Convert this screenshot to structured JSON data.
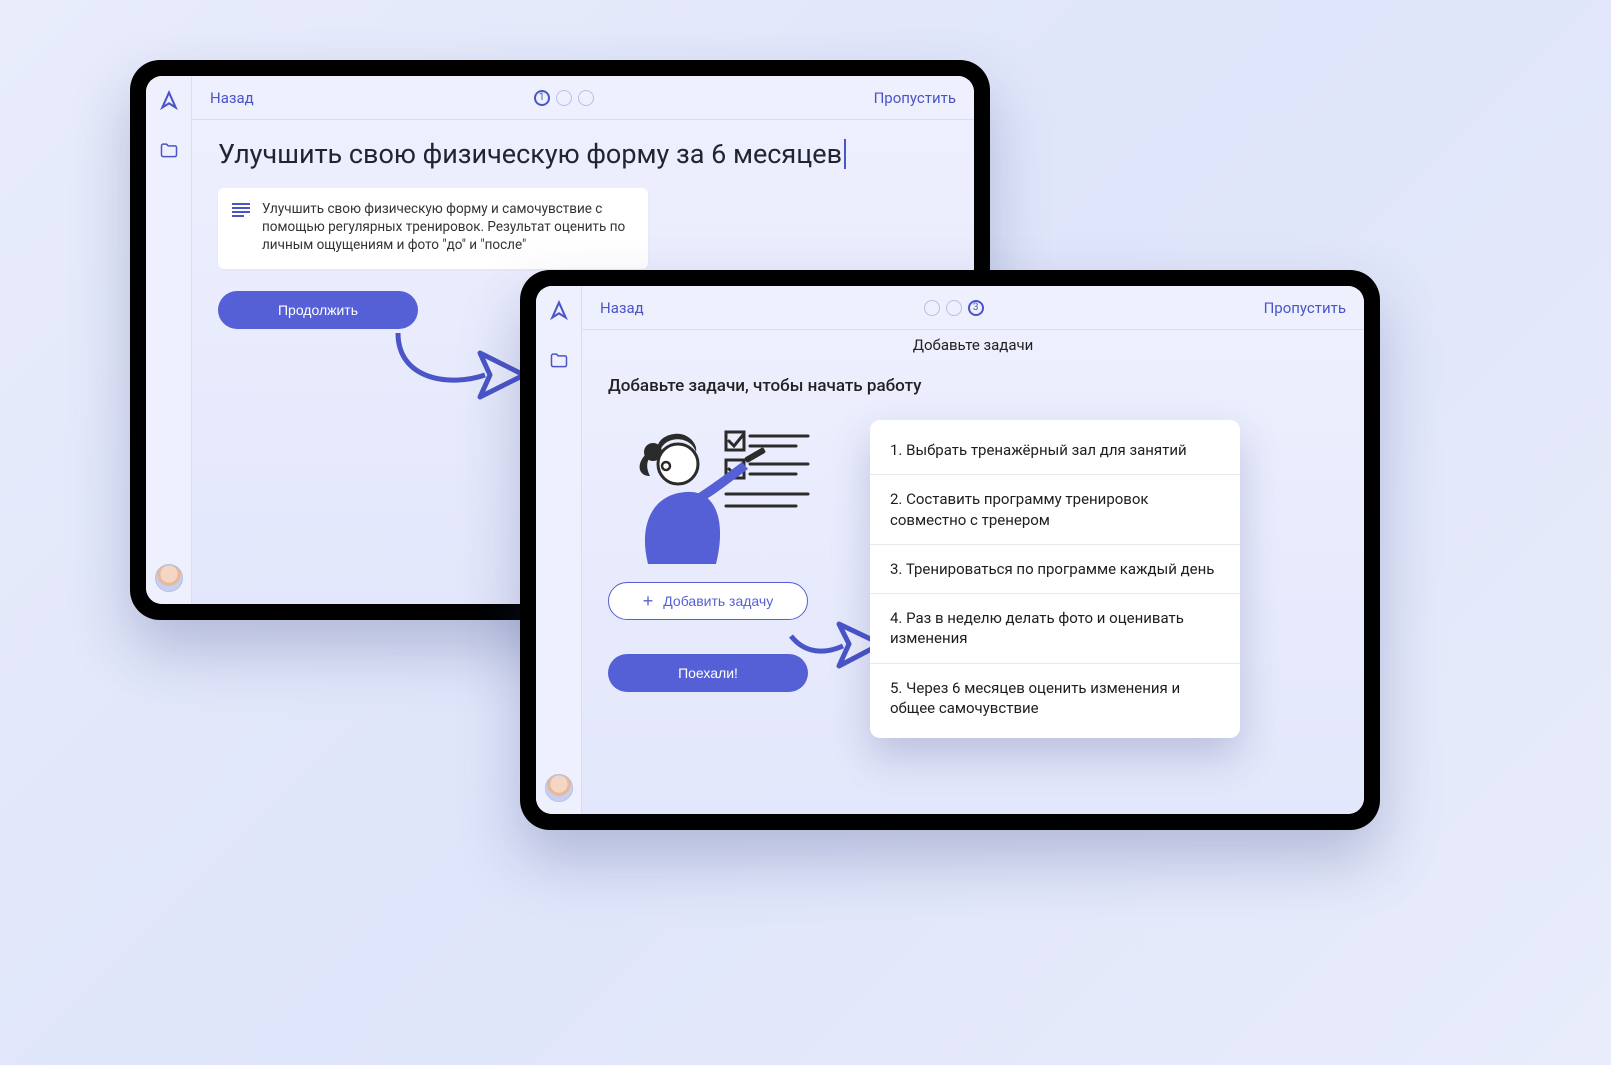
{
  "colors": {
    "accent": "#5560d6",
    "accent_dark": "#4a55c7",
    "bg_grad_a": "#e8ecfb",
    "bg_grad_b": "#dfe5fa"
  },
  "screen1": {
    "back_label": "Назад",
    "skip_label": "Пропустить",
    "step_current": 1,
    "step_total": 3,
    "goal_title": "Улучшить свою физическую форму за 6 месяцев",
    "note": "Улучшить свою физическую форму и самочувствие с помощью регулярных тренировок. Результат оценить по личным ощущениям и фото \"до\" и \"после\"",
    "continue_label": "Продолжить"
  },
  "screen2": {
    "back_label": "Назад",
    "skip_label": "Пропустить",
    "step_current": 3,
    "step_total": 3,
    "screen_title": "Добавьте задачи",
    "prompt": "Добавьте задачи, чтобы начать работу",
    "add_task_label": "Добавить задачу",
    "go_label": "Поехали!"
  },
  "tasks": [
    "1. Выбрать тренажёрный зал для занятий",
    "2. Составить программу тренировок совместно с тренером",
    "3. Тренироваться по программе каждый день",
    "4. Раз в неделю делать фото и оценивать изменения",
    "5. Через 6 месяцев оценить изменения и общее самочувствие"
  ]
}
